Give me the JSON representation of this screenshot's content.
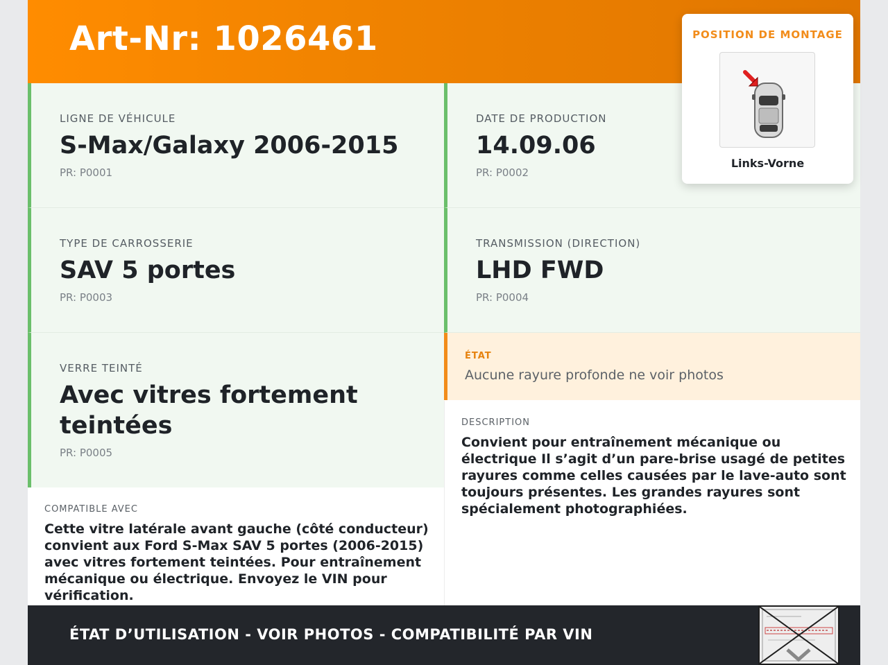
{
  "header": {
    "title": "Art-Nr: 1026461"
  },
  "mounting": {
    "title": "POSITION DE MONTAGE",
    "position": "Links-Vorne",
    "icon": "car-top-view-icon"
  },
  "fields": [
    {
      "label": "LIGNE DE VÉHICULE",
      "value": "S-Max/Galaxy 2006-2015",
      "pr": "PR: P0001"
    },
    {
      "label": "DATE DE PRODUCTION",
      "value": "14.09.06",
      "pr": "PR: P0002"
    },
    {
      "label": "TYPE DE CARROSSERIE",
      "value": "SAV 5 portes",
      "pr": "PR: P0003"
    },
    {
      "label": "TRANSMISSION (DIRECTION)",
      "value": "LHD FWD",
      "pr": "PR: P0004"
    },
    {
      "label": "VERRE TEINTÉ",
      "value": "Avec vitres fortement teintées",
      "pr": "PR: P0005"
    }
  ],
  "state": {
    "label": "ÉTAT",
    "text": "Aucune rayure profonde ne voir photos"
  },
  "description": {
    "label": "DESCRIPTION",
    "text": "Convient pour entraînement mécanique ou électrique Il s’agit d’un pare-brise usagé de petites rayures comme celles causées par le lave-auto sont toujours présentes. Les grandes rayures sont spécialement photographiées."
  },
  "compatible": {
    "label": "COMPATIBLE AVEC",
    "text": "Cette vitre latérale avant gauche (côté conducteur) convient aux Ford S-Max SAV 5 portes (2006-2015) avec vitres fortement teintées. Pour entraînement mécanique ou électrique. Envoyez le VIN pour vérification."
  },
  "footer": {
    "text": "ÉTAT D’UTILISATION - VOIR PHOTOS - COMPATIBILITÉ PAR VIN",
    "stamp_icon": "glass-label-stamp-icon"
  },
  "colors": {
    "accent": "#ff8c00",
    "green_border": "#6bbf6b",
    "state_bg": "#fff1dd",
    "footer_bg": "#23262b"
  }
}
